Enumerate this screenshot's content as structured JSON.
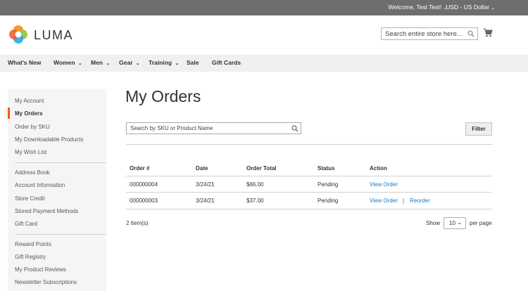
{
  "topbar": {
    "welcome": "Welcome, Test Test!",
    "currency": "USD - US Dollar"
  },
  "header": {
    "logo_text": "LUMA",
    "search_placeholder": "Search entire store here...",
    "cart_icon": "cart-icon"
  },
  "nav": {
    "items": [
      {
        "label": "What's New"
      },
      {
        "label": "Women"
      },
      {
        "label": "Men"
      },
      {
        "label": "Gear"
      },
      {
        "label": "Training"
      },
      {
        "label": "Sale"
      },
      {
        "label": "Gift Cards"
      }
    ]
  },
  "sidebar": {
    "accent_color": "#ff5501",
    "items": [
      {
        "label": "My Account"
      },
      {
        "label": "My Orders"
      },
      {
        "label": "Order by SKU"
      },
      {
        "label": "My Downloadable Products"
      },
      {
        "label": "My Wish List"
      },
      {
        "label": "Address Book"
      },
      {
        "label": "Account Information"
      },
      {
        "label": "Store Credit"
      },
      {
        "label": "Stored Payment Methods"
      },
      {
        "label": "Gift Card"
      },
      {
        "label": "Reward Points"
      },
      {
        "label": "Gift Registry"
      },
      {
        "label": "My Product Reviews"
      },
      {
        "label": "Newsletter Subscriptions"
      }
    ]
  },
  "main": {
    "title": "My Orders",
    "search_placeholder": "Search by SKU or Product Name",
    "filter_label": "Filter",
    "table": {
      "headers": [
        "Order #",
        "Date",
        "Order Total",
        "Status",
        "Action"
      ],
      "rows": [
        {
          "order": "000000004",
          "date": "3/24/21",
          "total": "$66.00",
          "status": "Pending",
          "view": "View Order",
          "reorder": ""
        },
        {
          "order": "000000003",
          "date": "3/24/21",
          "total": "$37.00",
          "status": "Pending",
          "view": "View Order",
          "reorder": "Reorder"
        }
      ],
      "action_separator": "|"
    },
    "toolbar": {
      "items_count": "2 Item(s)",
      "show_label": "Show",
      "per_page_value": "10",
      "per_page_label": "per page"
    },
    "link_color": "#1979c3"
  }
}
